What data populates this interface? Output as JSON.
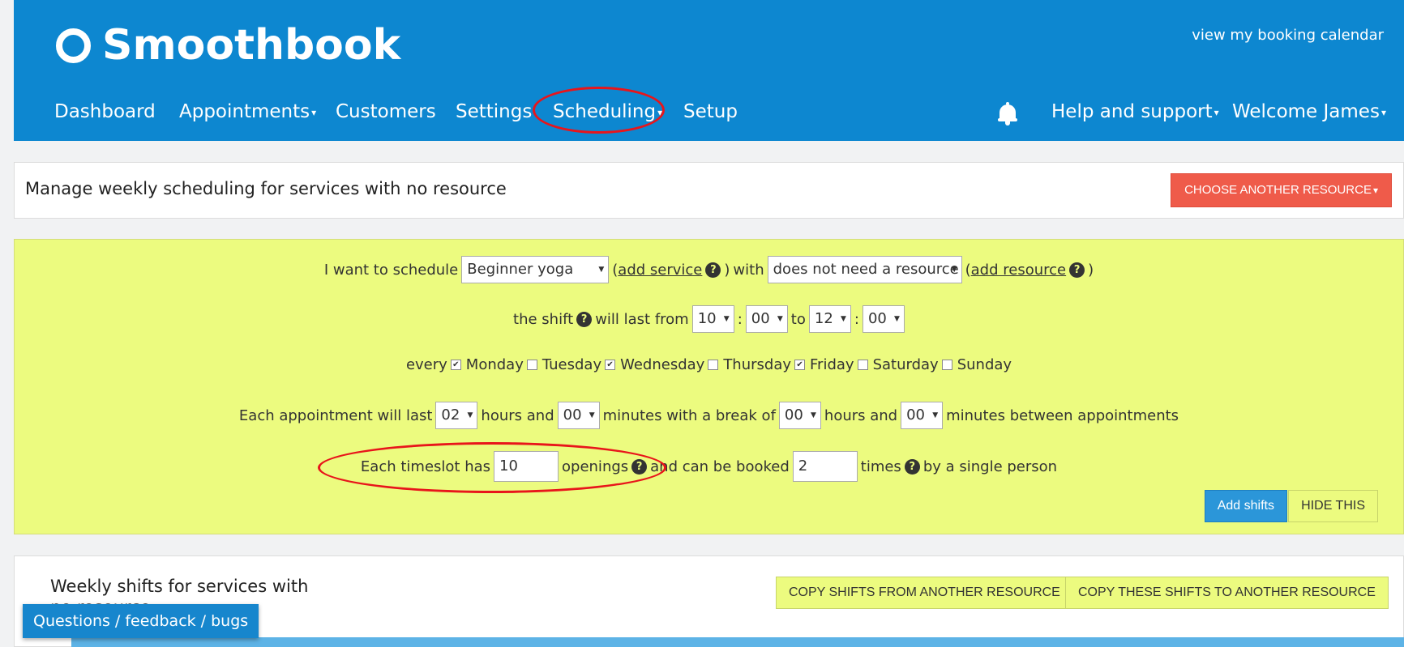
{
  "header": {
    "logo_text": "Smoothbook",
    "view_calendar": "view my booking calendar",
    "nav": [
      {
        "label": "Dashboard"
      },
      {
        "label": "Appointments"
      },
      {
        "label": "Customers"
      },
      {
        "label": "Settings"
      },
      {
        "label": "Scheduling"
      },
      {
        "label": "Setup"
      }
    ],
    "help": "Help and support",
    "welcome": "Welcome James"
  },
  "manage": {
    "title": "Manage weekly scheduling for services with no resource",
    "choose_button": "CHOOSE ANOTHER RESOURCE"
  },
  "form": {
    "row1": {
      "prefix": "I want to schedule",
      "service": "Beginner yoga",
      "add_service": "add service",
      "with": "with",
      "resource": "does not need a resource",
      "add_resource": "add resource"
    },
    "row2": {
      "prefix": "the shift",
      "will_last": "will last from",
      "from_hour": "10",
      "from_min": "00",
      "to": "to",
      "to_hour": "12",
      "to_min": "00"
    },
    "row3": {
      "prefix": "every",
      "days": [
        {
          "label": "Monday",
          "checked": true,
          "mark": "✔"
        },
        {
          "label": "Tuesday",
          "checked": false,
          "mark": ""
        },
        {
          "label": "Wednesday",
          "checked": true,
          "mark": "✔"
        },
        {
          "label": "Thursday",
          "checked": false,
          "mark": ""
        },
        {
          "label": "Friday",
          "checked": true,
          "mark": "✔"
        },
        {
          "label": "Saturday",
          "checked": false,
          "mark": ""
        },
        {
          "label": "Sunday",
          "checked": false,
          "mark": ""
        }
      ]
    },
    "row4": {
      "prefix": "Each appointment will last",
      "hours_value": "02",
      "hours_and": "hours and",
      "minutes_value": "00",
      "minutes_with_break": "minutes with a break of",
      "break_hours": "00",
      "hours_and2": "hours and",
      "break_minutes": "00",
      "suffix": "minutes between appointments"
    },
    "row5": {
      "prefix": "Each timeslot has",
      "openings_value": "10",
      "openings": "openings",
      "can_be_booked": "and can be booked",
      "times_value": "2",
      "times": "times",
      "suffix": "by a single person"
    },
    "add_shifts": "Add shifts",
    "hide_this": "HIDE THIS"
  },
  "shifts": {
    "title": "Weekly shifts for services with no resource",
    "copy_from": "COPY SHIFTS FROM ANOTHER RESOURCE",
    "copy_to": "COPY THESE SHIFTS TO ANOTHER RESOURCE"
  },
  "feedback": "Questions / feedback / bugs",
  "icons": {
    "question": "?",
    "caret": "▾"
  },
  "colors": {
    "header_blue": "#0d87d0",
    "form_yellow": "#ecfb7f",
    "danger_red": "#ef5b4a",
    "primary_blue": "#2b96d9",
    "annotation_red": "#e8151b"
  }
}
